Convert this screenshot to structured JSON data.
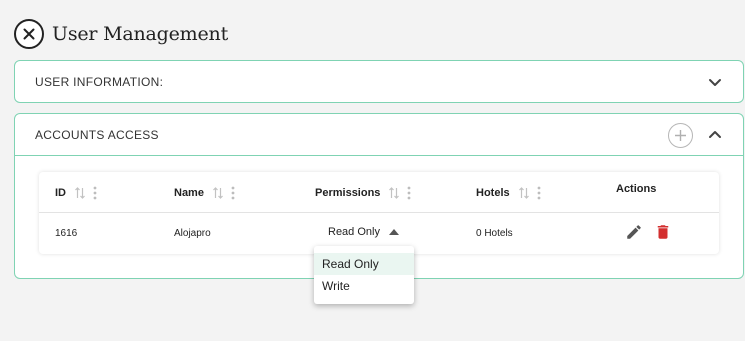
{
  "page": {
    "title": "User Management"
  },
  "sections": {
    "user_information": {
      "title": "USER INFORMATION:"
    },
    "accounts_access": {
      "title": "ACCOUNTS ACCESS"
    }
  },
  "table": {
    "columns": [
      {
        "label": "ID",
        "sortable": true
      },
      {
        "label": "Name",
        "sortable": true
      },
      {
        "label": "Permissions",
        "sortable": true
      },
      {
        "label": "Hotels",
        "sortable": true
      },
      {
        "label": "Actions",
        "sortable": false
      }
    ],
    "rows": [
      {
        "id": "1616",
        "name": "Alojapro",
        "permission": "Read Only",
        "hotels": "0 Hotels"
      }
    ]
  },
  "permission_dropdown": {
    "options": [
      "Read Only",
      "Write"
    ],
    "selected": "Read Only"
  },
  "colors": {
    "accent_border": "#7fd3b3",
    "delete_red": "#d32f2f",
    "edit_gray": "#555555",
    "dropdown_highlight": "#eaf6f1"
  },
  "icons": {
    "close": "close-icon",
    "expand": "chevron-down-icon",
    "collapse": "chevron-up-icon",
    "add": "plus-icon",
    "sort": "sort-icon",
    "column_menu": "kebab-menu-icon",
    "dropdown_caret": "caret-up-icon",
    "edit": "pencil-icon",
    "delete": "trash-icon"
  }
}
